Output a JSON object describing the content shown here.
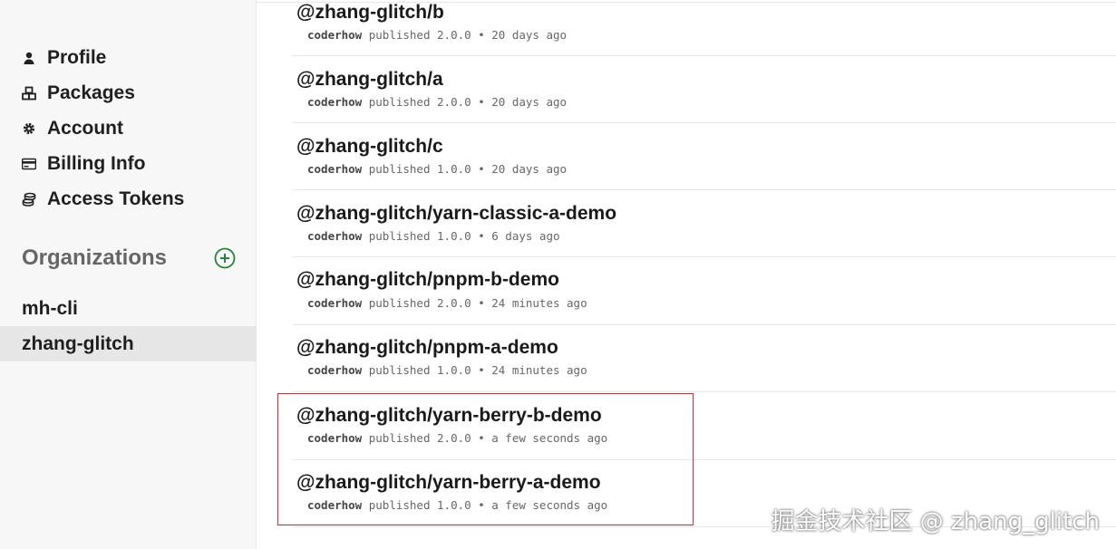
{
  "sidebar": {
    "items": [
      {
        "label": "Profile",
        "icon": "user-icon"
      },
      {
        "label": "Packages",
        "icon": "packages-icon"
      },
      {
        "label": "Account",
        "icon": "gear-icon"
      },
      {
        "label": "Billing Info",
        "icon": "credit-card-icon"
      },
      {
        "label": "Access Tokens",
        "icon": "tokens-icon"
      }
    ],
    "organizations_title": "Organizations",
    "add_icon_color": "#22863a",
    "organizations": [
      {
        "label": "mh-cli",
        "active": false
      },
      {
        "label": "zhang-glitch",
        "active": true
      }
    ]
  },
  "packages": [
    {
      "name": "@zhang-glitch/b",
      "user": "coderhow",
      "action": "published",
      "version": "2.0.0",
      "time": "20 days ago"
    },
    {
      "name": "@zhang-glitch/a",
      "user": "coderhow",
      "action": "published",
      "version": "2.0.0",
      "time": "20 days ago"
    },
    {
      "name": "@zhang-glitch/c",
      "user": "coderhow",
      "action": "published",
      "version": "1.0.0",
      "time": "20 days ago"
    },
    {
      "name": "@zhang-glitch/yarn-classic-a-demo",
      "user": "coderhow",
      "action": "published",
      "version": "1.0.0",
      "time": "6 days ago"
    },
    {
      "name": "@zhang-glitch/pnpm-b-demo",
      "user": "coderhow",
      "action": "published",
      "version": "2.0.0",
      "time": "24 minutes ago"
    },
    {
      "name": "@zhang-glitch/pnpm-a-demo",
      "user": "coderhow",
      "action": "published",
      "version": "1.0.0",
      "time": "24 minutes ago"
    },
    {
      "name": "@zhang-glitch/yarn-berry-b-demo",
      "user": "coderhow",
      "action": "published",
      "version": "2.0.0",
      "time": "a few seconds ago"
    },
    {
      "name": "@zhang-glitch/yarn-berry-a-demo",
      "user": "coderhow",
      "action": "published",
      "version": "1.0.0",
      "time": "a few seconds ago"
    }
  ],
  "separator": "•",
  "highlight_color": "#d0332f",
  "watermark": "掘金技术社区 @ zhang_glitch"
}
